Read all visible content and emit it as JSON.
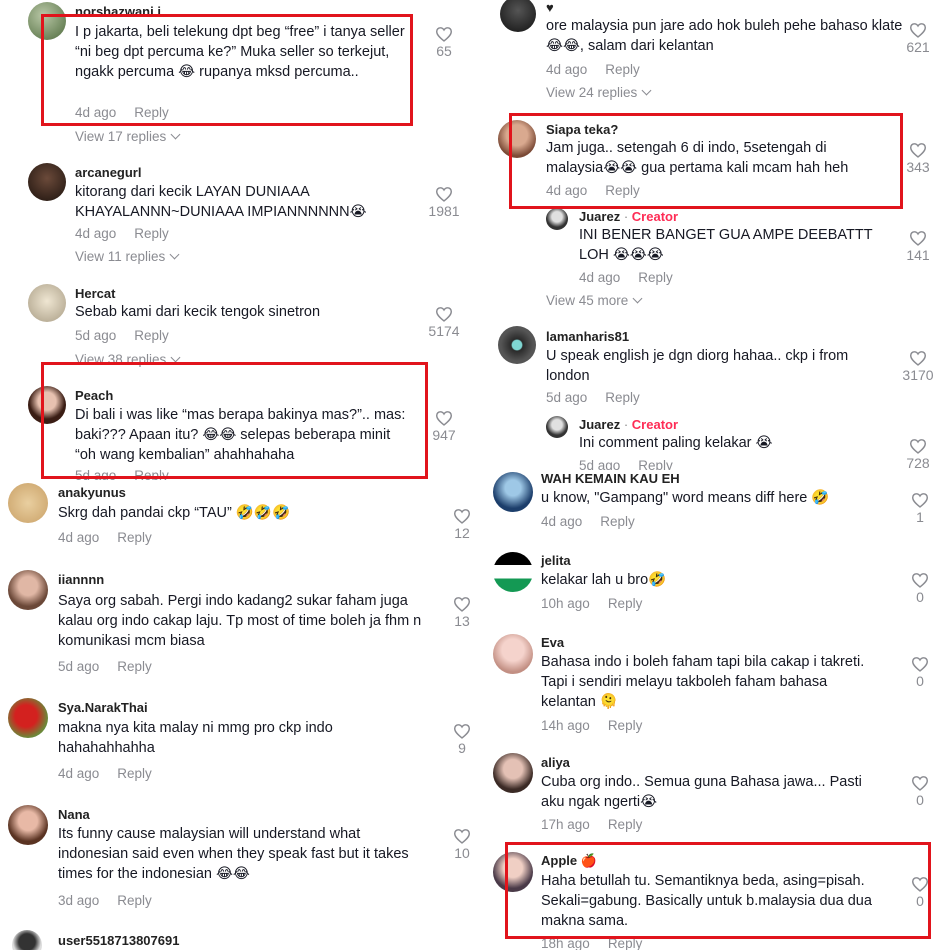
{
  "left_comments": [
    {
      "user": "norshazwani.i",
      "text": "I p jakarta, beli telekung dpt beg “free” i tanya seller “ni beg dpt percuma ke?” Muka seller so terkejut, ngakk percuma 😂 rupanya mksd percuma..",
      "time": "4d ago",
      "reply": "Reply",
      "likes": "65",
      "views": "View 17 replies"
    },
    {
      "user": "arcanegurl",
      "text": "kitorang dari kecik LAYAN DUNIAAA KHAYALANNN~DUNIAAA IMPIANNNNNN😭",
      "time": "4d ago",
      "reply": "Reply",
      "likes": "1981",
      "views": "View 11 replies"
    },
    {
      "user": "Hercat",
      "text": "Sebab kami dari kecik tengok sinetron",
      "time": "5d ago",
      "reply": "Reply",
      "likes": "5174",
      "views": "View 38 replies"
    },
    {
      "user": "Peach",
      "text": "Di bali i was like “mas berapa bakinya mas?”.. mas: baki??? Apaan itu? 😂😂 selepas beberapa minit “oh wang kembalian” ahahhahaha",
      "time": "5d ago",
      "reply": "Reply",
      "likes": "947"
    },
    {
      "user": "anakyunus",
      "text": "Skrg dah pandai ckp “TAU” 🤣🤣🤣",
      "time": "4d ago",
      "reply": "Reply",
      "likes": "12"
    },
    {
      "user": "iiannnn",
      "text": "Saya org sabah. Pergi indo kadang2 sukar faham juga kalau org indo cakap laju. Tp most of time boleh ja fhm n komunikasi mcm biasa",
      "time": "5d ago",
      "reply": "Reply",
      "likes": "13"
    },
    {
      "user": "Sya.NarakThai",
      "text": "makna nya kita malay ni mmg pro ckp indo hahahahhahha",
      "time": "4d ago",
      "reply": "Reply",
      "likes": "9"
    },
    {
      "user": "Nana",
      "text": "Its funny cause malaysian will understand what indonesian said even when they speak fast but it takes times for the indonesian 😂😂",
      "time": "3d ago",
      "reply": "Reply",
      "likes": "10"
    },
    {
      "user": "user5518713807691"
    }
  ],
  "right_comments": [
    {
      "user": "♥",
      "text": "ore malaysia pun jare ado hok buleh pehe bahaso klate😂😂, salam dari kelantan",
      "time": "4d ago",
      "reply": "Reply",
      "likes": "621",
      "views": "View 24 replies"
    },
    {
      "user": "Siapa teka?",
      "text": "Jam juga.. setengah 6 di indo, 5setengah di malaysia😭😭 gua pertama kali mcam hah heh",
      "time": "4d ago",
      "reply": "Reply",
      "likes": "343"
    },
    {
      "user": "Juarez",
      "creator": "Creator",
      "text": "INI BENER BANGET GUA AMPE DEEBATTT LOH 😭😭😭",
      "time": "4d ago",
      "reply": "Reply",
      "likes": "141",
      "views": "View 45 more"
    },
    {
      "user": "lamanharis81",
      "text": "U speak english je dgn diorg hahaa.. ckp i from london",
      "time": "5d ago",
      "reply": "Reply",
      "likes": "3170"
    },
    {
      "user": "Juarez",
      "creator": "Creator",
      "text": "Ini comment paling kelakar 😭",
      "time": "5d ago",
      "reply": "Reply",
      "likes": "728"
    },
    {
      "user": "WAH KEMAIN KAU EH",
      "text": "u know, \"Gampang\" word means diff here 🤣",
      "time": "4d ago",
      "reply": "Reply",
      "likes": "1"
    },
    {
      "user": "jelita",
      "text": "kelakar lah u bro🤣",
      "time": "10h ago",
      "reply": "Reply",
      "likes": "0"
    },
    {
      "user": "Eva",
      "text": "Bahasa indo i boleh faham tapi bila cakap i takreti. Tapi i sendiri melayu takboleh faham bahasa kelantan 🫠",
      "time": "14h ago",
      "reply": "Reply",
      "likes": "0"
    },
    {
      "user": "aliya",
      "text": "Cuba org indo.. Semua guna Bahasa jawa... Pasti aku ngak ngerti😭",
      "time": "17h ago",
      "reply": "Reply",
      "likes": "0"
    },
    {
      "user": "Apple",
      "badge": "🍎",
      "text": "Haha betullah tu. Semantiknya beda, asing=pisah. Sekali=gabung. Basically untuk b.malaysia dua dua makna sama.",
      "time": "18h ago",
      "reply": "Reply",
      "likes": "0"
    }
  ],
  "colors": {
    "highlight": "#e1141c",
    "muted": "#8a8b91",
    "creator": "#fe2c55"
  },
  "icons": {
    "like": "heart-outline-icon",
    "expand": "chevron-down-icon"
  }
}
